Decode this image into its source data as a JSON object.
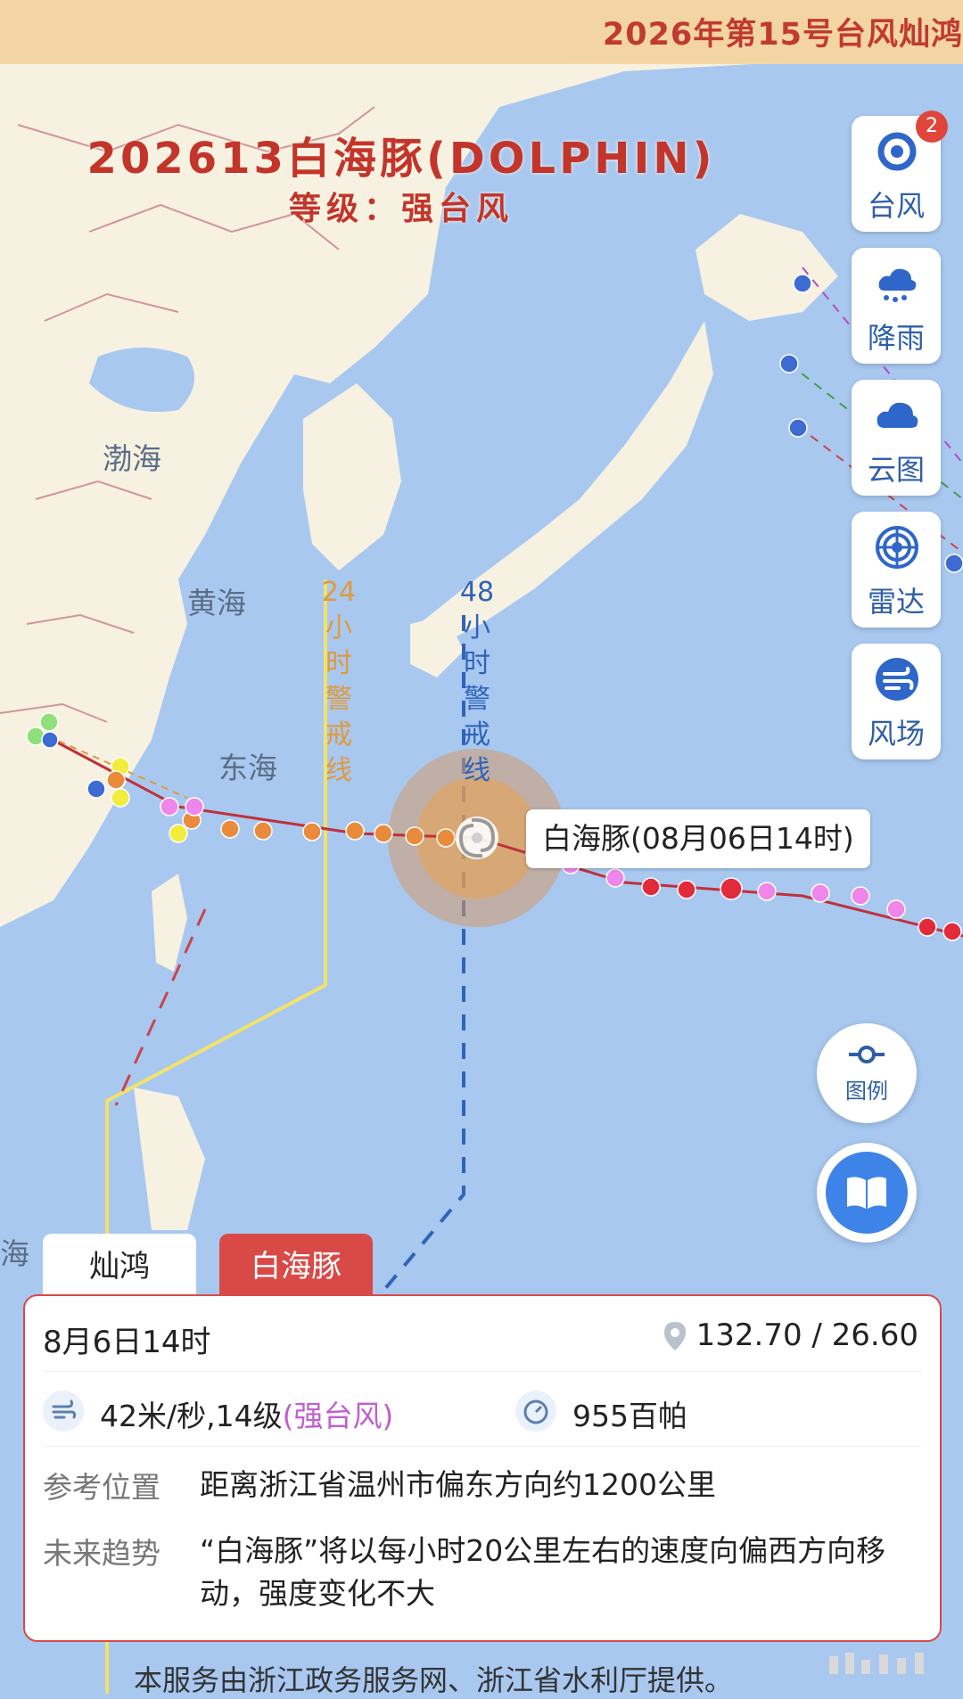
{
  "banner": {
    "title": "2026年第15号台风灿鸿"
  },
  "storm": {
    "title": "202613白海豚(DOLPHIN)",
    "level": "等级：强台风"
  },
  "map": {
    "seas": {
      "bohai": "渤海",
      "yellow_sea": "黄海",
      "east_sea": "东海",
      "edge": "海"
    },
    "warning_24": {
      "number": "24",
      "chars": [
        "小",
        "时",
        "警",
        "戒",
        "线"
      ],
      "color": "#e09a3a"
    },
    "warning_48": {
      "number": "48",
      "chars": [
        "小",
        "时",
        "警",
        "戒",
        "线"
      ],
      "color": "#2f64b8"
    },
    "callout": "白海豚(08月06日14时)"
  },
  "toolbar": {
    "items": [
      {
        "label": "台风",
        "icon": "typhoon-icon",
        "badge": "2"
      },
      {
        "label": "降雨",
        "icon": "rain-icon"
      },
      {
        "label": "云图",
        "icon": "cloud-icon"
      },
      {
        "label": "雷达",
        "icon": "radar-icon"
      },
      {
        "label": "风场",
        "icon": "wind-icon"
      }
    ],
    "legend_label": "图例"
  },
  "tabs": {
    "inactive": "灿鸿",
    "active": "白海豚"
  },
  "card": {
    "time": "8月6日14时",
    "coord": "132.70 / 26.60",
    "wind": "42米/秒,14级",
    "wind_level": "(强台风)",
    "pressure": "955百帕",
    "ref_key": "参考位置",
    "ref_val": "距离浙江省温州市偏东方向约1200公里",
    "trend_key": "未来趋势",
    "trend_val": "“白海豚”将以每小时20公里左右的速度向偏西方向移动，强度变化不大"
  },
  "footer": "本服务由浙江政务服务网、浙江省水利厅提供。",
  "colors": {
    "accent_red": "#d94a47",
    "title_red": "#c3352b",
    "link_blue": "#2e5fa8"
  }
}
